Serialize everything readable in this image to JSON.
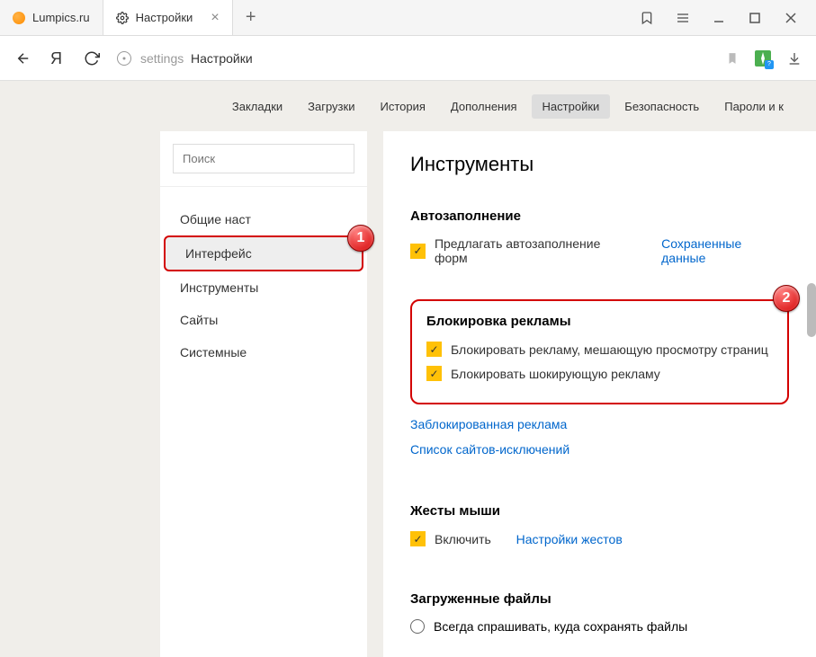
{
  "tabs": [
    {
      "label": "Lumpics.ru",
      "favicon": "orange"
    },
    {
      "label": "Настройки",
      "favicon": "gear"
    }
  ],
  "address": {
    "prefix": "settings",
    "title": "Настройки"
  },
  "navrow": {
    "items": [
      "Закладки",
      "Загрузки",
      "История",
      "Дополнения",
      "Настройки",
      "Безопасность",
      "Пароли и к"
    ],
    "active_index": 4
  },
  "sidebar": {
    "search_placeholder": "Поиск",
    "items": [
      "Общие наст",
      "Интерфейс",
      "Инструменты",
      "Сайты",
      "Системные"
    ],
    "selected_index": 1
  },
  "main": {
    "heading": "Инструменты",
    "autofill": {
      "title": "Автозаполнение",
      "check_label": "Предлагать автозаполнение форм",
      "link": "Сохраненные данные"
    },
    "adblock": {
      "title": "Блокировка рекламы",
      "check1": "Блокировать рекламу, мешающую просмотру страниц",
      "check2": "Блокировать шокирующую рекламу",
      "link1": "Заблокированная реклама",
      "link2": "Список сайтов-исключений"
    },
    "mouse": {
      "title": "Жесты мыши",
      "check_label": "Включить",
      "link": "Настройки жестов"
    },
    "downloads": {
      "title": "Загруженные файлы",
      "radio_label": "Всегда спрашивать, куда сохранять файлы"
    }
  },
  "annotations": {
    "badge1": "1",
    "badge2": "2"
  }
}
